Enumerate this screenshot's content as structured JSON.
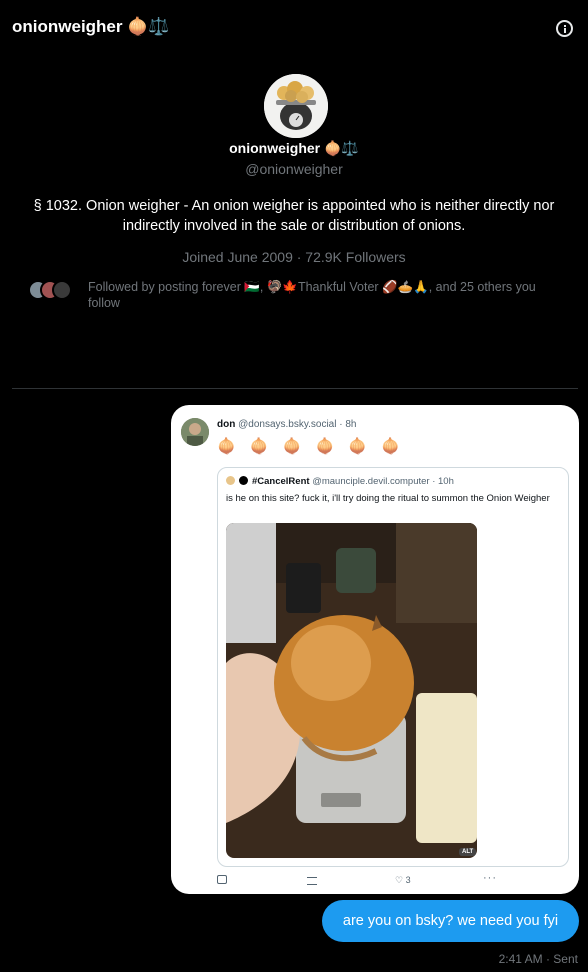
{
  "header": {
    "title": "onionweigher 🧅⚖️"
  },
  "profile": {
    "name": "onionweigher 🧅⚖️",
    "handle": "@onionweigher",
    "bio": "§ 1032. Onion weigher - An onion weigher is appointed who is neither directly nor indirectly involved in the sale or distribution of onions.",
    "meta": "Joined June 2009 · 72.9K Followers",
    "followed_by": "Followed by posting forever 🇵🇸, 🦃🍁Thankful Voter 🏈🥧🙏, and 25 others you follow"
  },
  "message_card": {
    "author_name": "don",
    "author_handle": "@donsays.bsky.social · 8h",
    "text": "🧅 🧅 🧅 🧅 🧅 🧅",
    "quote": {
      "author_name": "#CancelRent",
      "author_handle": "@maunciple.devil.computer · 10h",
      "text": "is he on this site? fuck it, i'll try doing the ritual to summon the Onion Weigher",
      "alt_badge": "ALT"
    },
    "likes": "3",
    "more": "···"
  },
  "message": {
    "text": "are you on bsky? we need you fyi",
    "status": "2:41 AM · Sent"
  },
  "colors": {
    "accent": "#1d9bf0",
    "background": "#000000",
    "muted": "#71767b"
  },
  "icons": [
    "info-icon",
    "reply-icon",
    "repost-icon",
    "heart-icon",
    "more-icon"
  ]
}
